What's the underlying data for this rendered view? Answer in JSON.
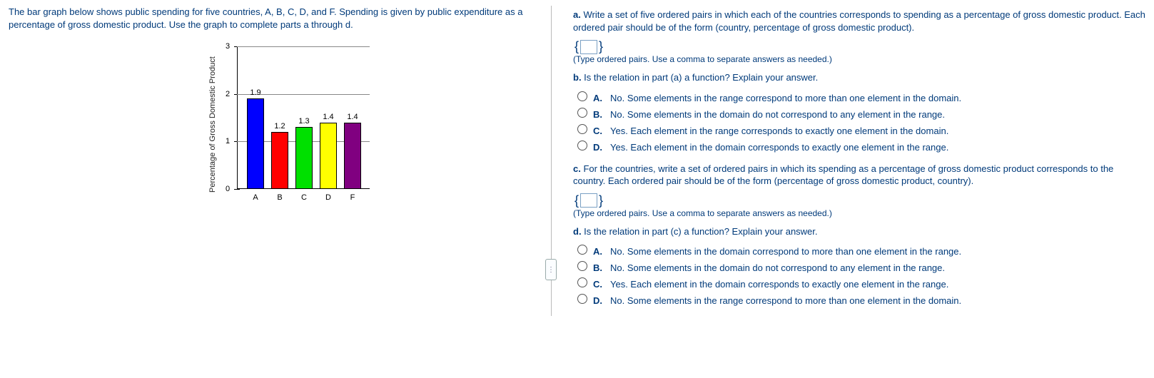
{
  "intro": "The bar graph below shows public spending for five countries, A, B, C, D, and F. Spending is given by public expenditure as a percentage of gross domestic product. Use the graph to complete parts a through d.",
  "chart_data": {
    "type": "bar",
    "ylabel": "Percentage of Gross Domestic Product",
    "ylim": [
      0,
      3
    ],
    "yticks": [
      "0",
      "1",
      "2",
      "3"
    ],
    "categories": [
      "A",
      "B",
      "C",
      "D",
      "F"
    ],
    "values": [
      1.9,
      1.2,
      1.3,
      1.4,
      1.4
    ],
    "value_labels": [
      "1.9",
      "1.2",
      "1.3",
      "1.4",
      "1.4"
    ],
    "colors": [
      "#0000ff",
      "#ff0000",
      "#00e000",
      "#ffff00",
      "#800080"
    ]
  },
  "qa": {
    "letter": "a.",
    "text": " Write a set of five ordered pairs in which each of the countries corresponds to spending as a percentage of gross domestic product. Each ordered pair should be of the form (country, percentage of gross domestic product).",
    "brace_l": "{",
    "brace_r": "}",
    "hint": "(Type ordered pairs. Use a comma to separate answers as needed.)"
  },
  "qb": {
    "letter": "b.",
    "text": " Is the relation in part (a) a function? Explain your answer.",
    "opts": [
      {
        "l": "A.",
        "t": "No. Some elements in the range correspond to more than one element in the domain."
      },
      {
        "l": "B.",
        "t": "No. Some elements in the domain do not correspond to any element in the range."
      },
      {
        "l": "C.",
        "t": "Yes. Each element in the range corresponds to exactly one element in the domain."
      },
      {
        "l": "D.",
        "t": "Yes. Each element in the domain corresponds to exactly one element in the range."
      }
    ]
  },
  "qc": {
    "letter": "c.",
    "text": " For the countries, write a set of ordered pairs in which its spending as a percentage of gross domestic product corresponds to the country. Each ordered pair should be of the form (percentage of gross domestic product, country).",
    "brace_l": "{",
    "brace_r": "}",
    "hint": "(Type ordered pairs. Use a comma to separate answers as needed.)"
  },
  "qd": {
    "letter": "d.",
    "text": " Is the relation in part (c) a function? Explain your answer.",
    "opts": [
      {
        "l": "A.",
        "t": "No. Some elements in the domain correspond to more than one element in the range."
      },
      {
        "l": "B.",
        "t": "No. Some elements in the domain do not correspond to any element in the range."
      },
      {
        "l": "C.",
        "t": "Yes. Each element in the domain corresponds to exactly one element in the range."
      },
      {
        "l": "D.",
        "t": "No. Some elements in the range correspond to more than one element in the domain."
      }
    ]
  },
  "expander_glyph": "⋮"
}
